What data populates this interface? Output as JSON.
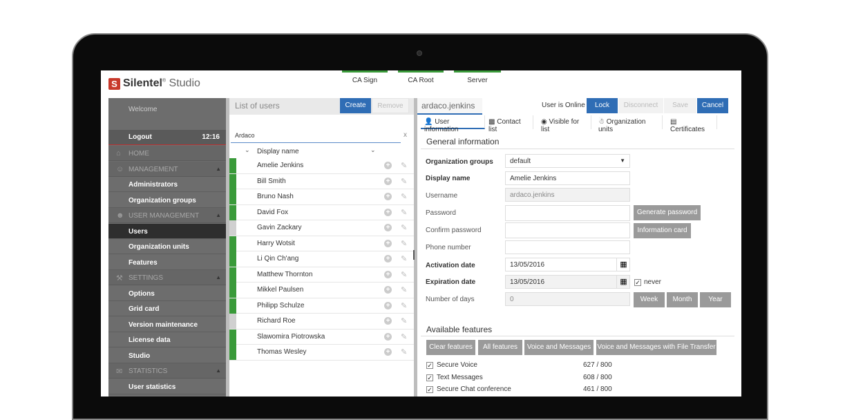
{
  "app": {
    "brand": "Silentel",
    "brand_sup": "®",
    "brand_suffix": "Studio"
  },
  "status_tabs": [
    "CA Sign",
    "CA Root",
    "Server"
  ],
  "sidebar": {
    "welcome": "Welcome",
    "logout": "Logout",
    "time": "12:16",
    "items": [
      {
        "type": "section",
        "label": "HOME",
        "icon": "home-icon"
      },
      {
        "type": "section",
        "label": "MANAGEMENT",
        "icon": "user-icon"
      },
      {
        "type": "item",
        "label": "Administrators"
      },
      {
        "type": "item",
        "label": "Organization groups"
      },
      {
        "type": "section",
        "label": "USER MANAGEMENT",
        "icon": "users-icon"
      },
      {
        "type": "item",
        "label": "Users",
        "active": true
      },
      {
        "type": "item",
        "label": "Organization units"
      },
      {
        "type": "item",
        "label": "Features"
      },
      {
        "type": "section",
        "label": "SETTINGS",
        "icon": "wrench-icon"
      },
      {
        "type": "item",
        "label": "Options"
      },
      {
        "type": "item",
        "label": "Grid card"
      },
      {
        "type": "item",
        "label": "Version maintenance"
      },
      {
        "type": "item",
        "label": "License data"
      },
      {
        "type": "item",
        "label": "Studio"
      },
      {
        "type": "section",
        "label": "STATISTICS",
        "icon": "chat-icon"
      },
      {
        "type": "item",
        "label": "User statistics"
      }
    ]
  },
  "users_list": {
    "title": "List of users",
    "create": "Create",
    "remove": "Remove",
    "filter_value": "Ardaco",
    "filter_clear": "x",
    "column": "Display name",
    "rows": [
      {
        "name": "Amelie Jenkins",
        "status": "green"
      },
      {
        "name": "Bill Smith",
        "status": "green"
      },
      {
        "name": "Bruno Nash",
        "status": "green"
      },
      {
        "name": "David Fox",
        "status": "green"
      },
      {
        "name": "Gavin Zackary",
        "status": "grey"
      },
      {
        "name": "Harry Wotsit",
        "status": "green"
      },
      {
        "name": "Li Qin Ch'ang",
        "status": "green"
      },
      {
        "name": "Matthew Thornton",
        "status": "green"
      },
      {
        "name": "Mikkel Paulsen",
        "status": "green"
      },
      {
        "name": "Philipp Schulze",
        "status": "green"
      },
      {
        "name": "Richard Roe",
        "status": "grey"
      },
      {
        "name": "Slawomira Piotrowska",
        "status": "green"
      },
      {
        "name": "Thomas Wesley",
        "status": "green"
      }
    ]
  },
  "details": {
    "username_header": "ardaco.jenkins",
    "online_status": "User is Online",
    "lock": "Lock",
    "disconnect": "Disconnect",
    "save": "Save",
    "cancel": "Cancel",
    "tabs": [
      "User information",
      "Contact list",
      "Visible for list",
      "Organization units",
      "Certificates"
    ],
    "general_title": "General information",
    "fields": {
      "org_groups_label": "Organization groups",
      "org_groups_value": "default",
      "display_name_label": "Display name",
      "display_name_value": "Amelie Jenkins",
      "username_label": "Username",
      "username_value": "ardaco.jenkins",
      "password_label": "Password",
      "confirm_password_label": "Confirm password",
      "phone_label": "Phone number",
      "activation_label": "Activation date",
      "activation_value": "13/05/2016",
      "expiration_label": "Expiration date",
      "expiration_value": "13/05/2016",
      "never_label": "never",
      "days_label": "Number of days",
      "days_value": "0"
    },
    "generate_password": "Generate password",
    "information_card": "Information card",
    "week": "Week",
    "month": "Month",
    "year": "Year",
    "features_title": "Available features",
    "feature_buttons": [
      "Clear features",
      "All features",
      "Voice and Messages",
      "Voice and Messages with File Transfer"
    ],
    "features": [
      {
        "name": "Secure Voice",
        "count": "627 / 800"
      },
      {
        "name": "Text Messages",
        "count": "608 / 800"
      },
      {
        "name": "Secure Chat conference",
        "count": "461 / 800"
      }
    ]
  },
  "colors": {
    "accent": "#2f6db5",
    "online": "#3a9a3a",
    "logo": "#c8392b"
  }
}
